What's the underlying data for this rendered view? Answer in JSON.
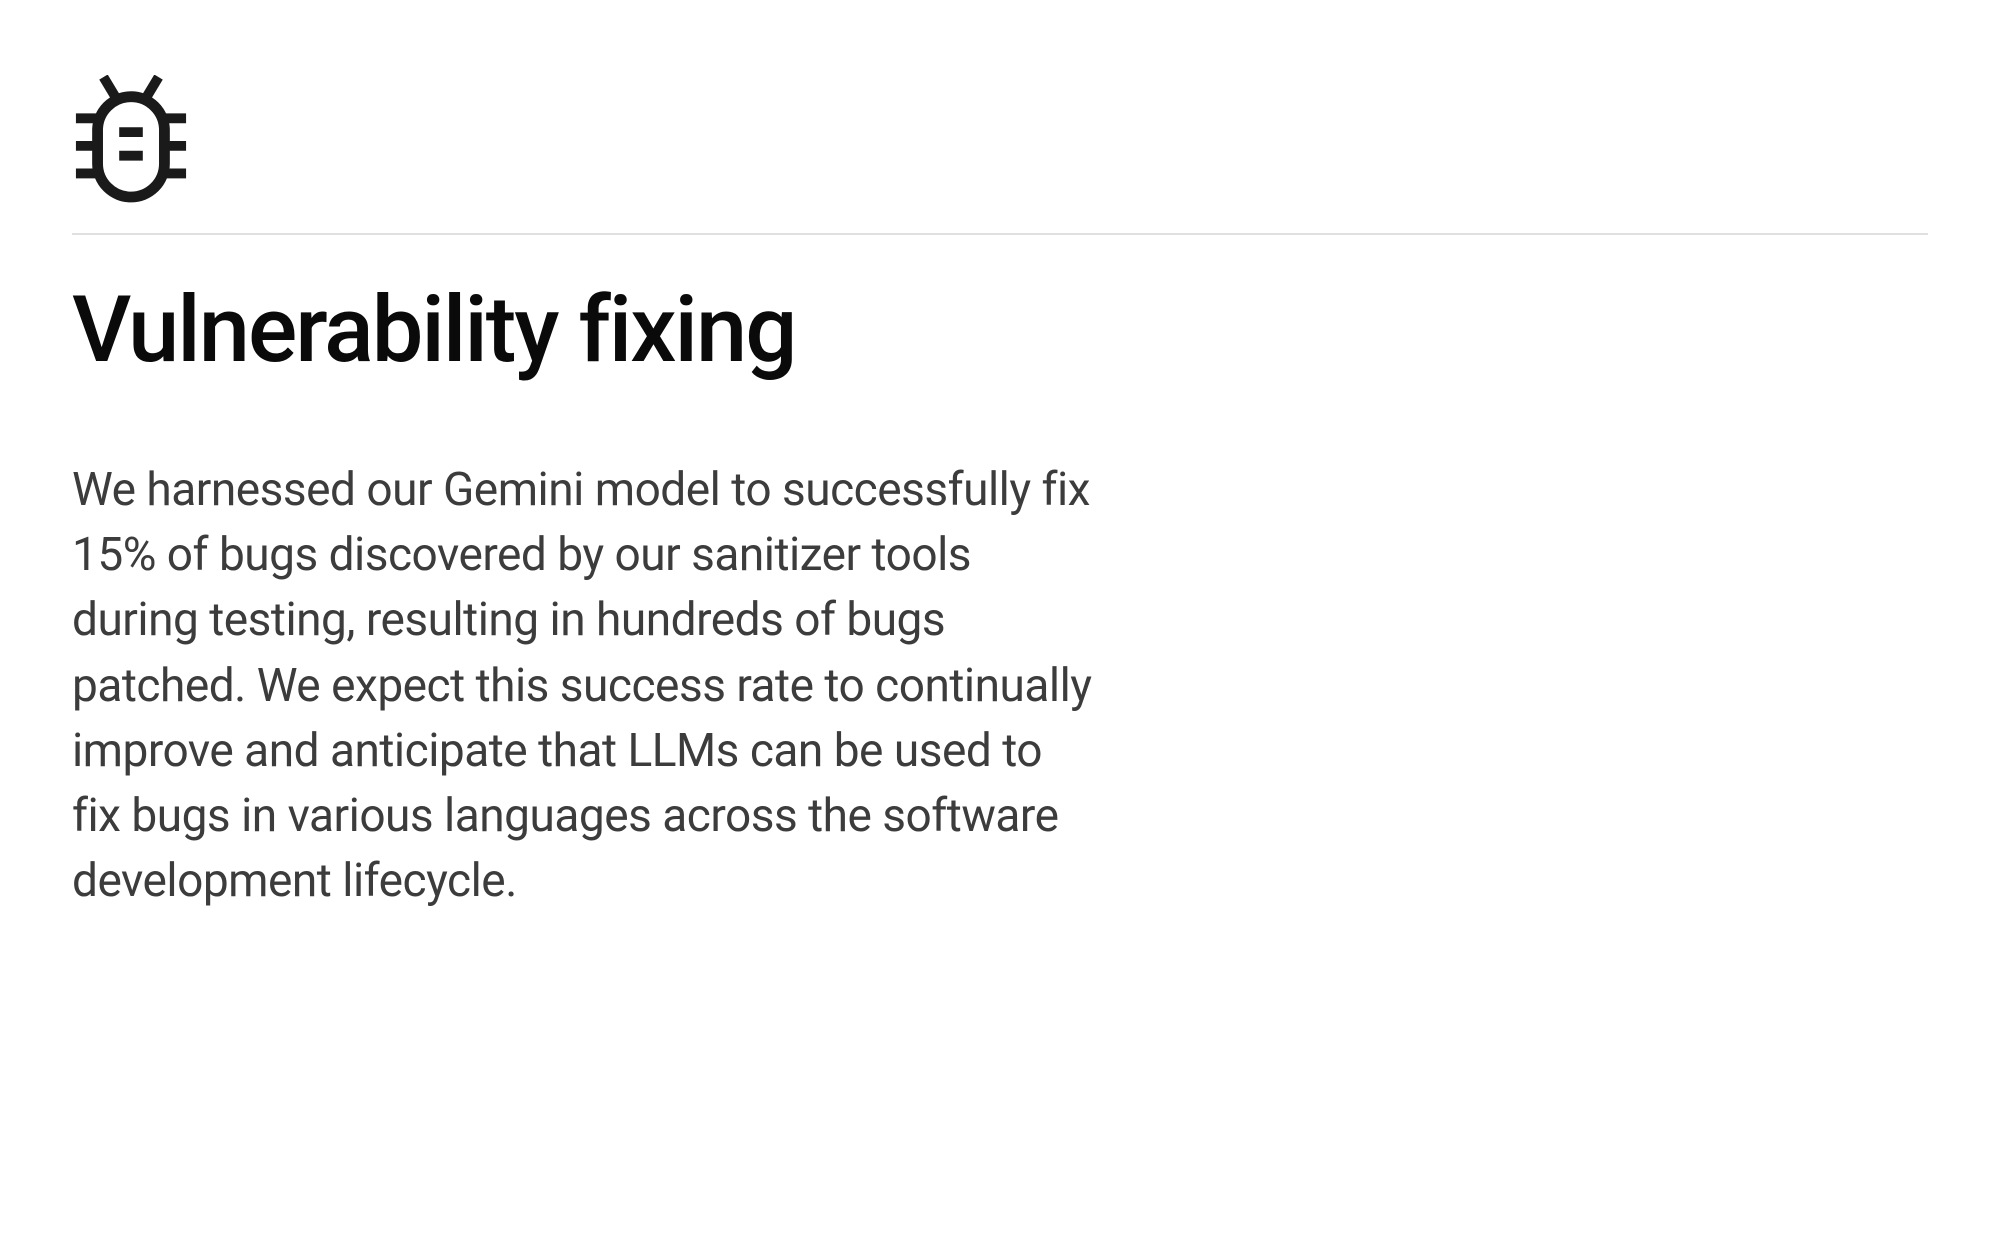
{
  "section": {
    "icon": "bug-icon",
    "heading": "Vulnerability fixing",
    "body": "We harnessed our Gemini model to successfully fix 15% of bugs discovered by our sanitizer tools during testing, resulting in hundreds of bugs patched. We expect this success rate to continually improve and anticipate that LLMs can be used to fix bugs in various languages across the software development lifecycle."
  }
}
